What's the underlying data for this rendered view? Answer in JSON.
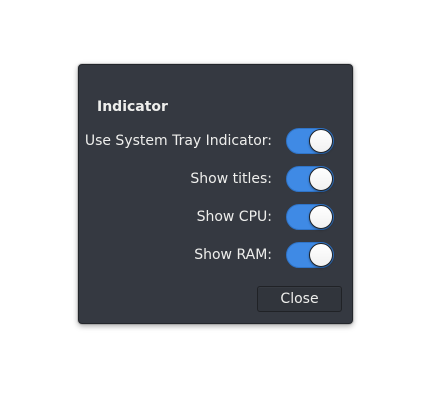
{
  "dialog": {
    "section_title": "Indicator",
    "options": [
      {
        "label": "Use System Tray Indicator:",
        "enabled": true
      },
      {
        "label": "Show titles:",
        "enabled": true
      },
      {
        "label": "Show CPU:",
        "enabled": true
      },
      {
        "label": "Show RAM:",
        "enabled": true
      }
    ],
    "close_label": "Close"
  },
  "colors": {
    "dialog_background": "#353941",
    "switch_on": "#3f8ae5",
    "text": "#eeeeec"
  }
}
